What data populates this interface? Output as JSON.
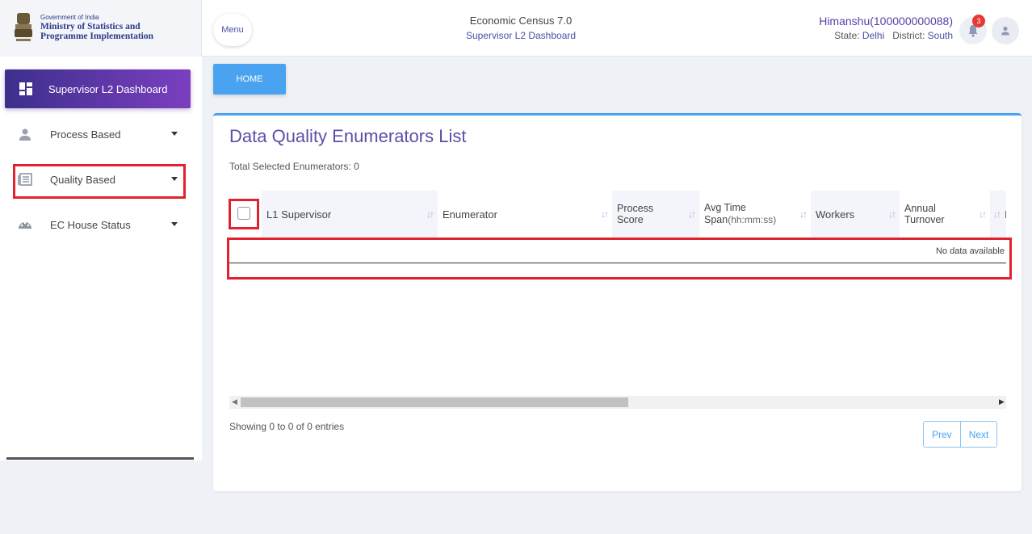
{
  "header": {
    "gov_label": "Government of India",
    "ministry_line1": "Ministry of Statistics and",
    "ministry_line2": "Programme Implementation",
    "menu_label": "Menu",
    "app_title": "Economic Census 7.0",
    "dashboard_title": "Supervisor L2 Dashboard",
    "user_name": "Himanshu(100000000088)",
    "state_label": "State:",
    "state_value": "Delhi",
    "district_label": "District:",
    "district_value": "South",
    "notification_count": "3"
  },
  "sidebar": {
    "active_item": {
      "label": "Supervisor L2 Dashboard",
      "icon": "dashboard-icon"
    },
    "items": [
      {
        "label": "Process Based",
        "icon": "person-icon"
      },
      {
        "label": "Quality Based",
        "icon": "newspaper-icon"
      },
      {
        "label": "EC House Status",
        "icon": "gauge-icon"
      }
    ]
  },
  "breadcrumb": {
    "home_label": "HOME"
  },
  "main": {
    "title": "Data Quality Enumerators List",
    "selected_text": "Total Selected Enumerators: 0",
    "columns": [
      {
        "label": "L1 Supervisor"
      },
      {
        "label": "Enumerator"
      },
      {
        "line1": "Process",
        "line2": "Score"
      },
      {
        "line1": "Avg Time",
        "line2": "Span",
        "unit": "(hh:mm:ss)"
      },
      {
        "label": "Workers"
      },
      {
        "line1": "Annual",
        "line2": "Turnover"
      },
      {
        "label": "Ir"
      }
    ],
    "empty_text": "No data available",
    "info_text": "Showing 0 to 0 of 0 entries",
    "prev_label": "Prev",
    "next_label": "Next"
  },
  "colors": {
    "accent_blue": "#4aa3f0",
    "sidebar_active_start": "#3d2f8c",
    "sidebar_active_end": "#7b3fbf",
    "highlight_red": "#e0222e",
    "title_purple": "#5b4fa8"
  }
}
